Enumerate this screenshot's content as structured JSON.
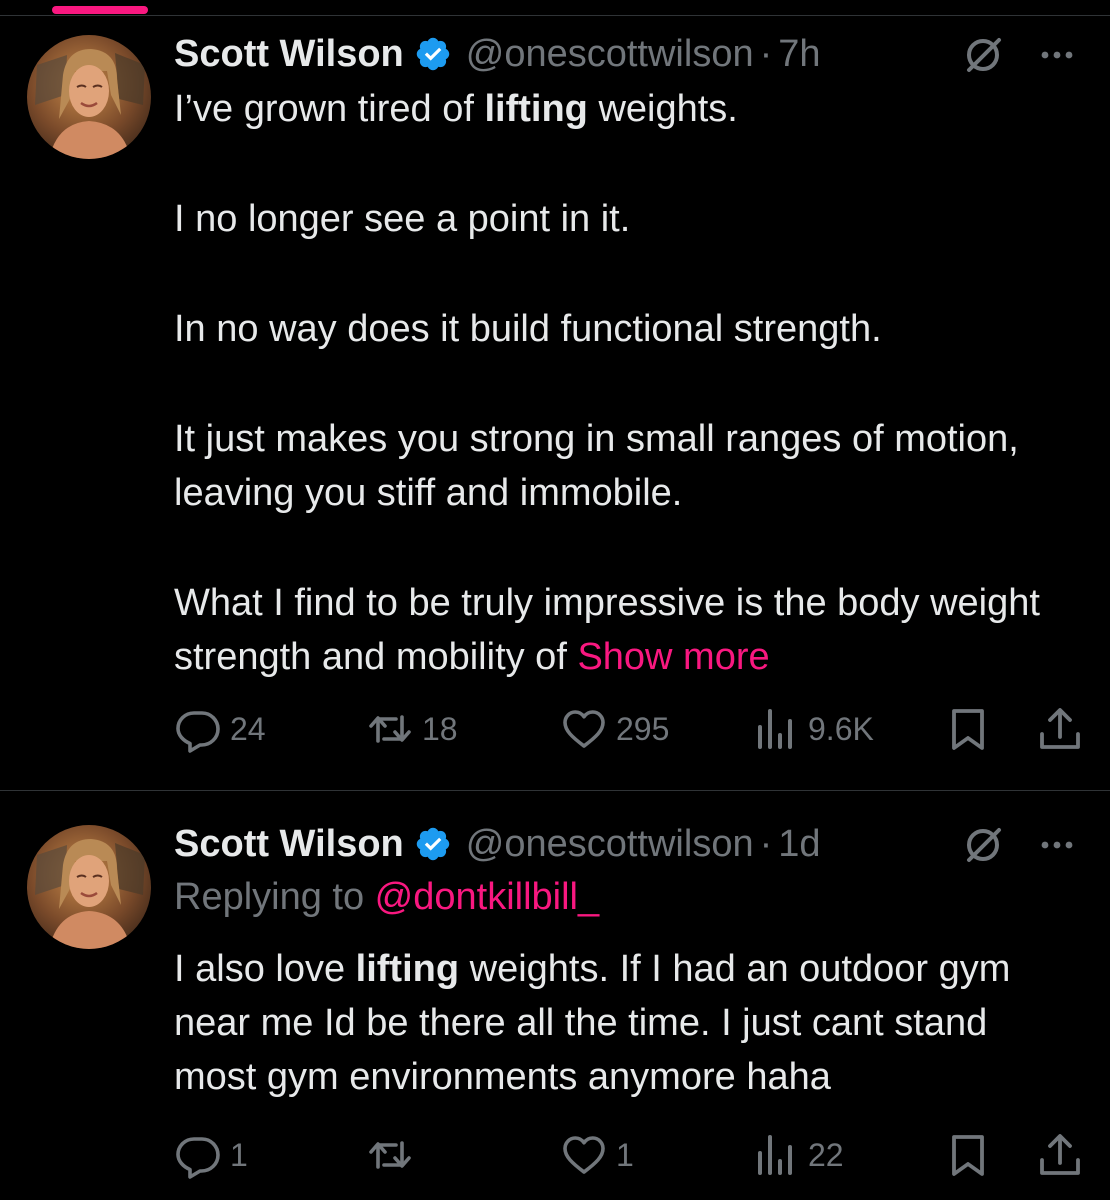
{
  "colors": {
    "background": "#000000",
    "text": "#e7e9ea",
    "secondary_text": "#71767b",
    "accent": "#f91880",
    "verified_badge": "#1d9bf0",
    "divider": "#2f3336"
  },
  "tweets": [
    {
      "author": {
        "name": "Scott Wilson",
        "handle": "@onescottwilson",
        "verified": true
      },
      "separator": "·",
      "time": "7h",
      "body": {
        "p1_a": "I’ve grown tired of ",
        "p1_bold": "lifting",
        "p1_b": " weights.",
        "p2": "I no longer see a point in it.",
        "p3": "In no way does it build functional strength.",
        "p4": "It just makes you strong in small ranges of motion, leaving you stiff and immobile.",
        "p5": "What I find to be truly impressive is the body weight strength and mobility of ",
        "show_more": "Show more"
      },
      "stats": {
        "replies": "24",
        "reposts": "18",
        "likes": "295",
        "views": "9.6K"
      }
    },
    {
      "author": {
        "name": "Scott Wilson",
        "handle": "@onescottwilson",
        "verified": true
      },
      "separator": "·",
      "time": "1d",
      "reply_to": {
        "prefix": "Replying to ",
        "mention": "@dontkillbill_"
      },
      "body": {
        "p1_a": "I also love ",
        "p1_bold": "lifting",
        "p1_b": " weights. If I had an outdoor gym near me Id be there all the time. I just cant stand most gym environments anymore haha"
      },
      "stats": {
        "replies": "1",
        "reposts": "",
        "likes": "1",
        "views": "22"
      }
    }
  ],
  "icons": {
    "reply": "speech-bubble-icon",
    "repost": "repost-arrows-icon",
    "like": "heart-icon",
    "views": "bar-chart-icon",
    "bookmark": "bookmark-icon",
    "share": "share-upload-icon",
    "grok": "grok-slash-circle-icon",
    "more": "ellipsis-icon",
    "verified": "verified-badge-icon"
  }
}
